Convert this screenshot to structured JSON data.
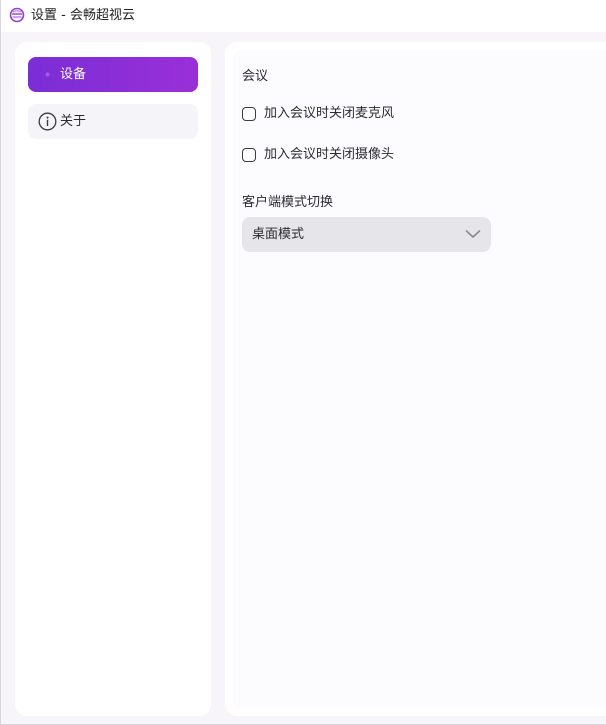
{
  "window": {
    "title": "设置 - 会畅超视云",
    "logo_icon": "app-logo-icon"
  },
  "sidebar": {
    "items": [
      {
        "label": "设备",
        "icon": "device-icon",
        "active": true
      },
      {
        "label": "关于",
        "icon": "info-circle-icon",
        "active": false
      }
    ]
  },
  "main": {
    "section_title": "会议",
    "options": [
      {
        "label": "加入会议时关闭麦克风",
        "checked": false
      },
      {
        "label": "加入会议时关闭摄像头",
        "checked": false
      }
    ],
    "client_mode": {
      "label": "客户端模式切换",
      "value": "桌面模式",
      "icon": "chevron-down-icon"
    }
  },
  "colors": {
    "accent_start": "#7a2ed6",
    "accent_end": "#9a2fd8",
    "background": "#f7f5f9"
  }
}
